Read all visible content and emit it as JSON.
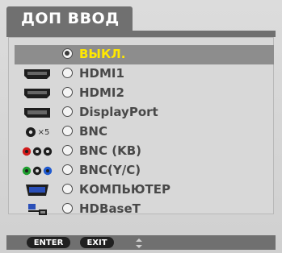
{
  "menu": {
    "title": "ДОП ВВОД"
  },
  "items": [
    {
      "label": "ВЫКЛ.",
      "icon": "none",
      "selected": true
    },
    {
      "label": "HDMI1",
      "icon": "hdmi-icon",
      "selected": false
    },
    {
      "label": "HDMI2",
      "icon": "hdmi-icon",
      "selected": false
    },
    {
      "label": "DisplayPort",
      "icon": "displayport-icon",
      "selected": false
    },
    {
      "label": "BNC",
      "icon": "bnc-icon",
      "selected": false,
      "icon_text": "×5"
    },
    {
      "label": "BNC (KB)",
      "icon": "bnc-cv-icon",
      "selected": false
    },
    {
      "label": "BNC(Y/C)",
      "icon": "bnc-yc-icon",
      "selected": false
    },
    {
      "label": "КОМПЬЮТЕР",
      "icon": "computer-icon",
      "selected": false
    },
    {
      "label": "HDBaseT",
      "icon": "hdbaset-icon",
      "selected": false
    }
  ],
  "footer": {
    "enter_label": "ENTER",
    "exit_label": "EXIT",
    "updown_icon": "up-down-arrows-icon"
  },
  "colors": {
    "header": "#707070",
    "selected_row": "#8d8d8d",
    "selected_text": "#ffe800",
    "text": "#484848",
    "panel": "#d8d8d8"
  }
}
